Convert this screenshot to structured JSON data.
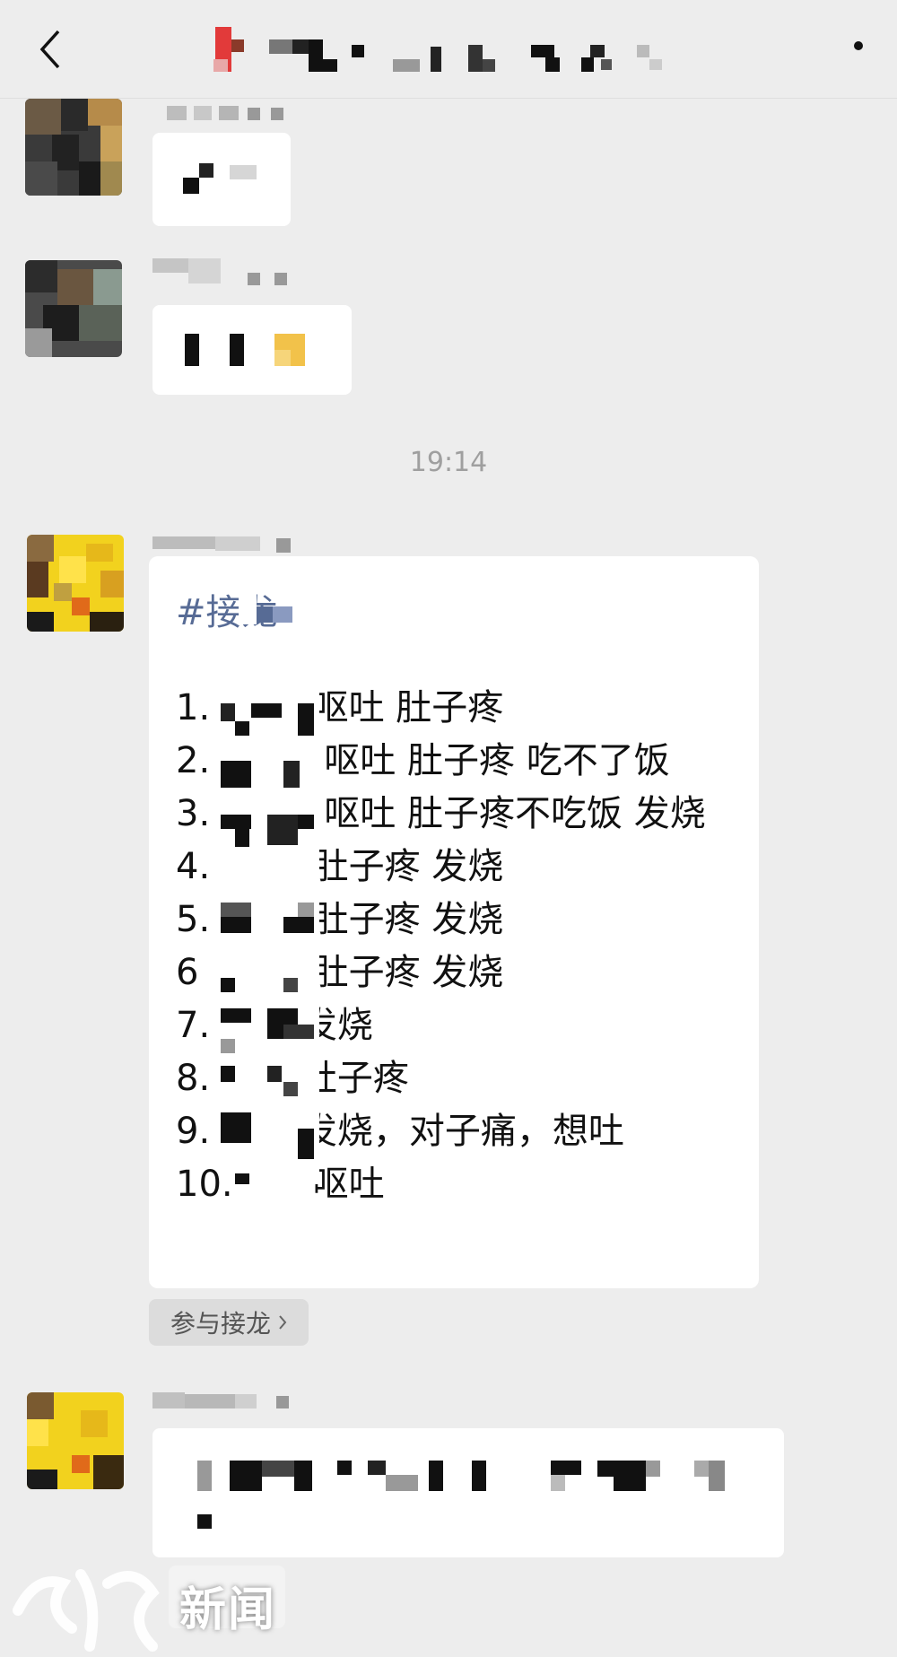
{
  "header": {
    "back_icon": "chevron-left-icon",
    "more_icon": "dot-menu-icon"
  },
  "timestamp": "19:14",
  "solitaire": {
    "tag": "#接龙",
    "entries": [
      "1.         呕吐 肚子疼",
      "2.          呕吐 肚子疼 吃不了饭",
      "3.          呕吐 肚子疼不吃饭 发烧",
      "4.         肚子疼 发烧",
      "5.         肚子疼 发烧",
      "6          肚子疼 发烧",
      "7.        发烧",
      "8.        肚子疼",
      "9.        发烧，对子痛，想吐",
      "10.       呕吐"
    ],
    "join_label": "参与接龙",
    "join_icon": "chevron-right-icon"
  },
  "watermark": {
    "text": "新闻"
  },
  "colors": {
    "background": "#ededed",
    "bubble": "#ffffff",
    "link": "#576b95",
    "time": "#9f9f9f"
  }
}
